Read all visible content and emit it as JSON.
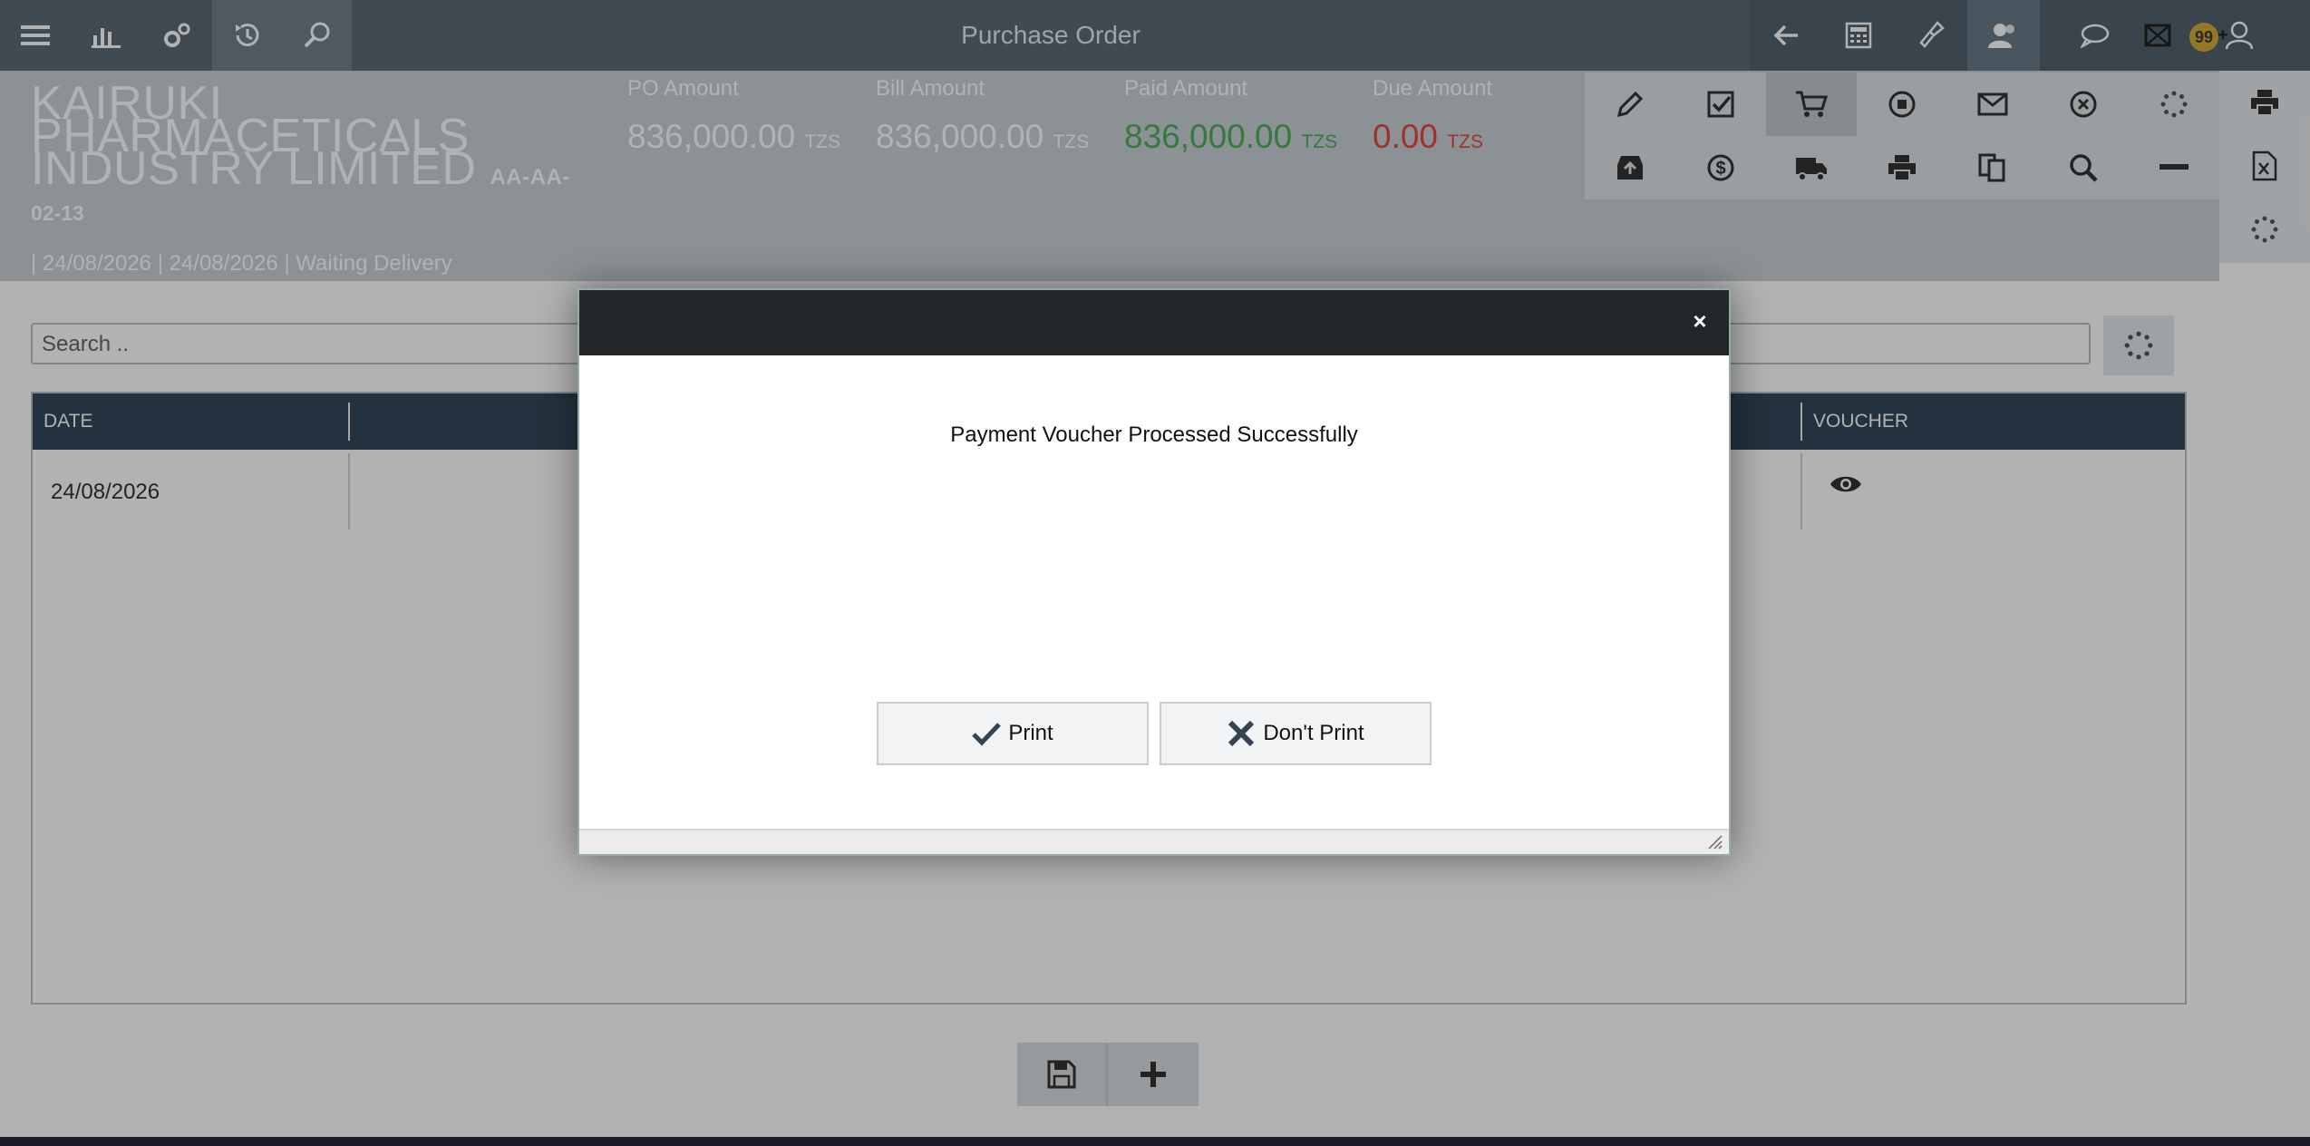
{
  "app": {
    "title": "Purchase Order"
  },
  "notifications": {
    "count": "99",
    "plus": "+"
  },
  "header": {
    "company_name": "KAIRUKI PHARMACETICALS INDUSTRY LIMITED",
    "code_part1": "AA-AA-",
    "code_part2": "02-13",
    "subinfo": "| 24/08/2026 | 24/08/2026 | Waiting Delivery"
  },
  "metrics": [
    {
      "label": "PO Amount",
      "value": "836,000.00",
      "currency": "TZS",
      "color": "#ffffff"
    },
    {
      "label": "Bill Amount",
      "value": "836,000.00",
      "currency": "TZS",
      "color": "#ffffff"
    },
    {
      "label": "Paid Amount",
      "value": "836,000.00",
      "currency": "TZS",
      "color": "#4cae5a"
    },
    {
      "label": "Due Amount",
      "value": "0.00",
      "currency": "TZS",
      "color": "#e24a3b"
    }
  ],
  "search": {
    "placeholder": "Search .."
  },
  "table": {
    "columns": [
      "DATE",
      "VOUCHER"
    ],
    "rows": [
      {
        "date": "24/08/2026"
      }
    ]
  },
  "modal": {
    "message": "Payment Voucher Processed Successfully",
    "print_label": "Print",
    "dont_print_label": "Don't Print",
    "close_symbol": "×"
  },
  "colors": {
    "accent": "#33485a",
    "topbar": "#5b6b78",
    "modal_header": "#232629"
  }
}
